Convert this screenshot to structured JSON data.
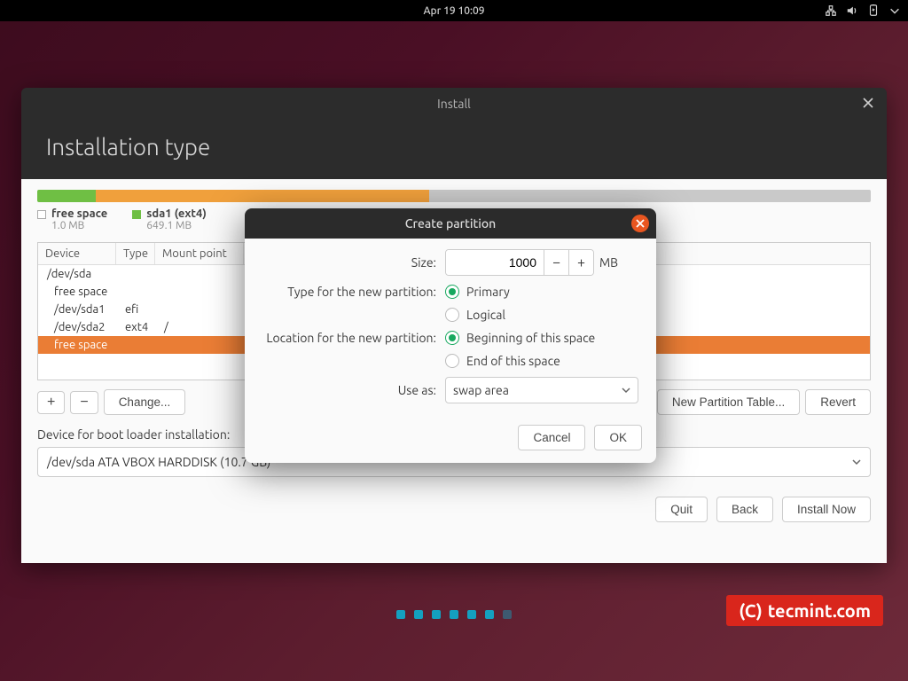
{
  "topbar": {
    "datetime": "Apr 19  10:09"
  },
  "window": {
    "title": "Install",
    "heading": "Installation type"
  },
  "partition_bar": [
    {
      "color": "#6fbf44",
      "width_pct": 1.0
    },
    {
      "color": "#6fbf44",
      "width_pct": 6.0
    },
    {
      "color": "#f0a03c",
      "width_pct": 40.0
    },
    {
      "color": "#c9c9c9",
      "width_pct": 53.0
    }
  ],
  "legend": [
    {
      "name": "free space",
      "size": "1.0 MB",
      "color": "#ffffff",
      "border": "#aaa"
    },
    {
      "name": "sda1 (ext4)",
      "size": "649.1 MB",
      "color": "#6fbf44",
      "border": "#6fbf44"
    }
  ],
  "table": {
    "headers": [
      "Device",
      "Type",
      "Mount point"
    ],
    "rows": [
      {
        "cells": [
          "/dev/sda",
          "",
          ""
        ],
        "indent": false,
        "selected": false
      },
      {
        "cells": [
          "free space",
          "",
          ""
        ],
        "indent": true,
        "selected": false
      },
      {
        "cells": [
          "/dev/sda1",
          "efi",
          ""
        ],
        "indent": true,
        "selected": false
      },
      {
        "cells": [
          "/dev/sda2",
          "ext4",
          "/"
        ],
        "indent": true,
        "selected": false
      },
      {
        "cells": [
          "free space",
          "",
          ""
        ],
        "indent": true,
        "selected": true
      }
    ]
  },
  "table_controls": {
    "add": "+",
    "remove": "−",
    "change": "Change...",
    "new_table": "New Partition Table...",
    "revert": "Revert"
  },
  "boot": {
    "label": "Device for boot loader installation:",
    "value": "/dev/sda   ATA VBOX HARDDISK (10.7 GB)"
  },
  "footer": {
    "quit": "Quit",
    "back": "Back",
    "install": "Install Now"
  },
  "dialog": {
    "title": "Create partition",
    "size_label": "Size:",
    "size_value": "1000",
    "size_unit": "MB",
    "type_label": "Type for the new partition:",
    "type_primary": "Primary",
    "type_logical": "Logical",
    "loc_label": "Location for the new partition:",
    "loc_begin": "Beginning of this space",
    "loc_end": "End of this space",
    "useas_label": "Use as:",
    "useas_value": "swap area",
    "cancel": "Cancel",
    "ok": "OK"
  },
  "watermark": {
    "text": "tecmint.com",
    "prefix": "(C)"
  }
}
